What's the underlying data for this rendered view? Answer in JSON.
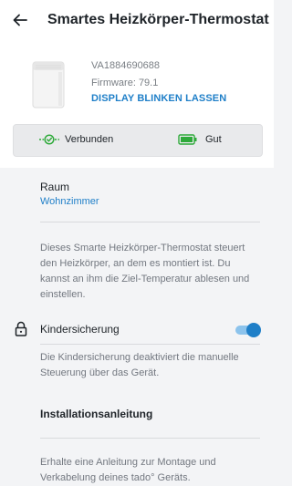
{
  "header": {
    "title": "Smartes Heizkörper-Thermostat",
    "back_icon": "arrow-left-icon"
  },
  "device": {
    "serial": "VA1884690688",
    "firmware": "Firmware: 79.1",
    "blink_action": "DISPLAY BLINKEN LASSEN"
  },
  "status": {
    "connection_label": "Verbunden",
    "connection_icon": "link-check-icon",
    "battery_label": "Gut",
    "battery_icon": "battery-full-icon",
    "color": "#2eaa3a"
  },
  "room": {
    "label": "Raum",
    "value": "Wohnzimmer"
  },
  "description": "Dieses Smarte Heizkörper-Thermostat steuert den Heizkörper, an dem es montiert ist. Du kannst an ihm die Ziel-Temperatur ablesen und einstellen.",
  "child_lock": {
    "label": "Kindersicherung",
    "enabled": true,
    "description": "Die Kindersicherung deaktiviert die manuelle Steuerung über das Gerät."
  },
  "install": {
    "title": "Installationsanleitung",
    "description": "Erhalte eine Anleitung zur Montage und Verkabelung deines tado° Geräts."
  },
  "colors": {
    "accent": "#1f7fc8",
    "background": "#f3f4f6"
  }
}
